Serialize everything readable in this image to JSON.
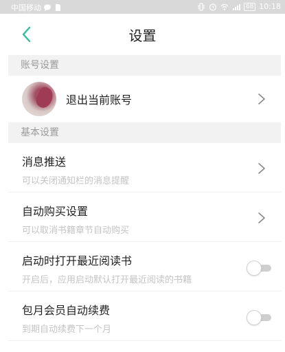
{
  "status_bar": {
    "carrier": "中国移动",
    "time": "10:18",
    "battery": "68",
    "icons": [
      "chat-bubble-icon",
      "sim-icon",
      "vibrate-icon",
      "alarm-icon",
      "wifi-icon",
      "signal-icon"
    ]
  },
  "header": {
    "title": "设置",
    "back_icon": "chevron-left-icon"
  },
  "colors": {
    "accent": "#2bbf9a",
    "subtitle": "#c4c4c4",
    "section_bg": "#f2f2f2"
  },
  "sections": {
    "account": {
      "label": "账号设置",
      "logout_label": "退出当前账号"
    },
    "basic": {
      "label": "基本设置",
      "items": [
        {
          "title": "消息推送",
          "subtitle": "可以关闭通知栏的消息提醒",
          "control": "chevron",
          "enabled": null
        },
        {
          "title": "自动购买设置",
          "subtitle": "可以取消书籍章节自动购买",
          "control": "chevron",
          "enabled": null
        },
        {
          "title": "启动时打开最近阅读书",
          "subtitle": "开启后，应用启动默认打开最近阅读的书籍",
          "control": "toggle",
          "enabled": false
        },
        {
          "title": "包月会员自动续费",
          "subtitle": "到期自动续费下一个月",
          "control": "toggle",
          "enabled": false
        }
      ]
    }
  }
}
